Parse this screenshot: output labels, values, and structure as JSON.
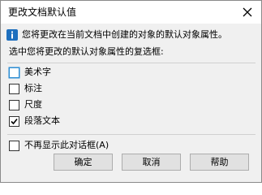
{
  "window": {
    "title": "更改文档默认值"
  },
  "info": {
    "line1": "您将更改在当前文档中创建的对象的默认对象属性。",
    "line2": "选中您将更改的默认对象属性的复选框:"
  },
  "options": [
    {
      "label": "美术字",
      "checked": false
    },
    {
      "label": "标注",
      "checked": false
    },
    {
      "label": "尺度",
      "checked": false
    },
    {
      "label": "段落文本",
      "checked": true
    }
  ],
  "dont_show": {
    "label": "不再显示此对话框(A)",
    "checked": false
  },
  "buttons": {
    "ok": "确定",
    "cancel": "取消",
    "help": "帮助"
  },
  "colors": {
    "info_icon": "#1e6fbe",
    "focus_border": "#2a8dd4"
  }
}
